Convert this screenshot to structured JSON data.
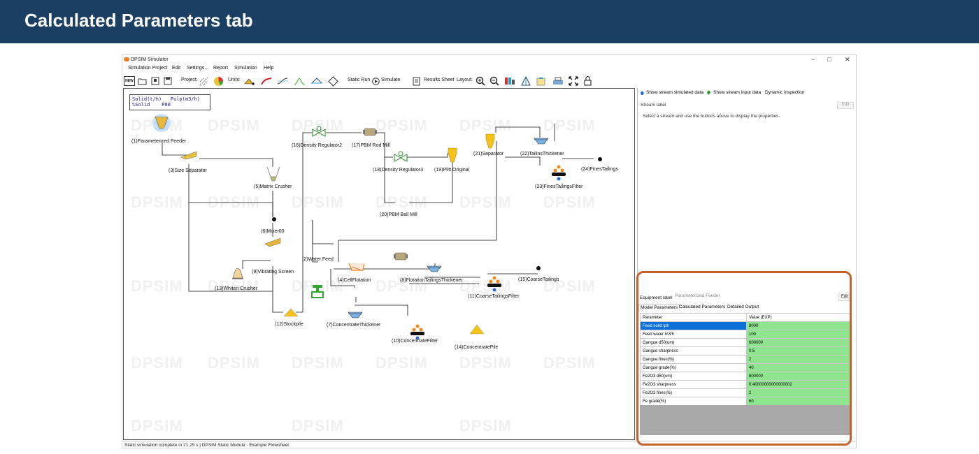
{
  "slide": {
    "title": "Calculated Parameters tab"
  },
  "window": {
    "title": "DPSIM Simulator",
    "controls": {
      "minimize": "−",
      "maximize": "□",
      "close": "✕"
    }
  },
  "menu": [
    "Simulation Project",
    "Edit",
    "Settings...",
    "Report",
    "Simulation",
    "Help"
  ],
  "toolbar": {
    "new_label": "NEW",
    "project_label": "Project:",
    "units_label": "Units:",
    "static_run_label": "Static Run",
    "simulate_label": "Simulate",
    "results_sheet_label": "Results Sheet",
    "layout_label": "Layout:"
  },
  "canvas": {
    "legend": "Solid(t/h)   Pulp(m3/h)\n%Solid    P80",
    "watermark": "DPSIM",
    "units": [
      "(1)Parameterized Feeder",
      "(3)Size Separator",
      "(5)Matrix Crusher",
      "(6)Mixer00",
      "(9)Vibrating Screen",
      "(13)Whiten Crusher",
      "(12)Stockpile",
      "(16)Density Regulator2",
      "(17)PBM Rod Mill",
      "(18)Density Regulator3",
      "(19)Plitt Original",
      "(20)PBM Ball Mill",
      "(21)Separator",
      "(22)TailinsThickener",
      "(24)FinesTailings",
      "(23)FinesTailingsFilter",
      "(2)Water Feed",
      "(4)CellFlotation",
      "(8)FlotationTailingsThickener",
      "(11)CoarseTailingsFilter",
      "(15)CoarseTailings",
      "(7)ConcentrateThickener",
      "(10)ConcentrateFilter",
      "(14)ConcentratePile"
    ]
  },
  "right_panel": {
    "show_simulated": "Show stream simulated data",
    "show_input": "Show stream input data",
    "dynamic_inspection": "Dynamic inspection",
    "stream_label": "Stream label",
    "edit": "Edit",
    "instruction": "Select a stream and use the buttons above to display the properties."
  },
  "equipment": {
    "label": "Equipment label",
    "value": "Parameterized Feeder",
    "edit": "Edit",
    "tabs": [
      "Model Parameters",
      "Calculated Parameters",
      "Detailed Output"
    ],
    "columns": [
      "Parameter",
      "Value (EXP)"
    ],
    "rows": [
      [
        "Feed solid tph",
        "8000"
      ],
      [
        "Feed water m3/h",
        "100"
      ],
      [
        "Gangue d50(um)",
        "600000"
      ],
      [
        "Gangue sharpness",
        "0.5"
      ],
      [
        "Gangue fines(%)",
        "2"
      ],
      [
        "Gangue grade(%)",
        "40"
      ],
      [
        "Fe2O3 d50(um)",
        "800000"
      ],
      [
        "Fe2O3 sharpness",
        "0.40000000000000002"
      ],
      [
        "Fe2O3 fines(%)",
        "2"
      ],
      [
        "Fe grade(%)",
        "60"
      ]
    ]
  },
  "status": "Static simulation complete in 21.25 s  | DPSIM Static Module - Example Flowsheet",
  "colors": {
    "header_bg": "#1b3f63",
    "highlight": "#c5622b",
    "value_green": "#8fe48f",
    "selected_blue": "#0a6fd6"
  }
}
